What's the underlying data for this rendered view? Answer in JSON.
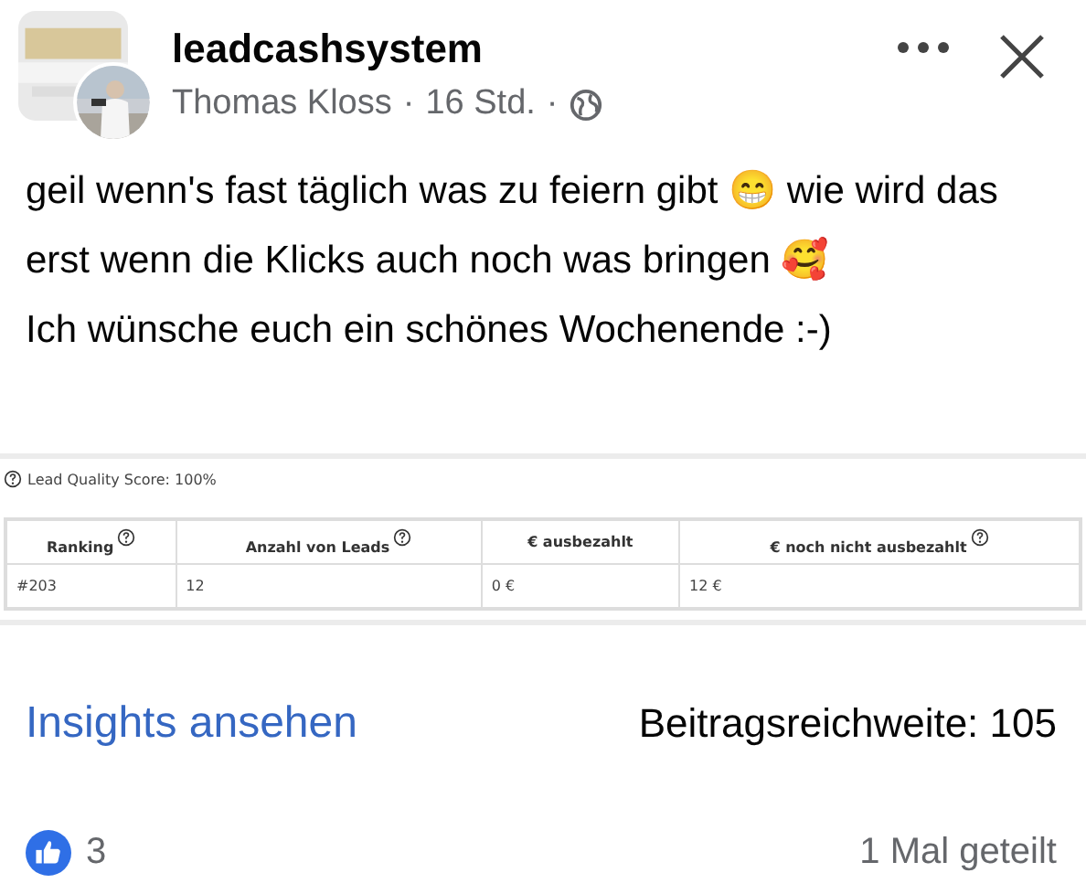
{
  "post": {
    "author": "leadcashsystem",
    "poster": "Thomas Kloss",
    "time": "16 Std.",
    "separator": "·",
    "paragraphs": [
      "geil wenn's fast täglich was zu feiern gibt 😁 wie wird das erst wenn die Klicks auch noch was bringen 🥰",
      "Ich wünsche euch ein schönes Wochenende :-)"
    ]
  },
  "embedded": {
    "score": "Lead Quality Score: 100%",
    "table": {
      "columns": [
        {
          "label": "Ranking",
          "help": true
        },
        {
          "label": "Anzahl von Leads",
          "help": true
        },
        {
          "label": "€ ausbezahlt",
          "help": false
        },
        {
          "label": "€ noch nicht ausbezahlt",
          "help": true
        }
      ],
      "rows": [
        [
          "#203",
          "12",
          "0 €",
          "12 €"
        ]
      ]
    }
  },
  "insights": {
    "link": "Insights ansehen",
    "reach": "Beitragsreichweite: 105"
  },
  "footer": {
    "likes": "3",
    "shares": "1 Mal geteilt"
  }
}
